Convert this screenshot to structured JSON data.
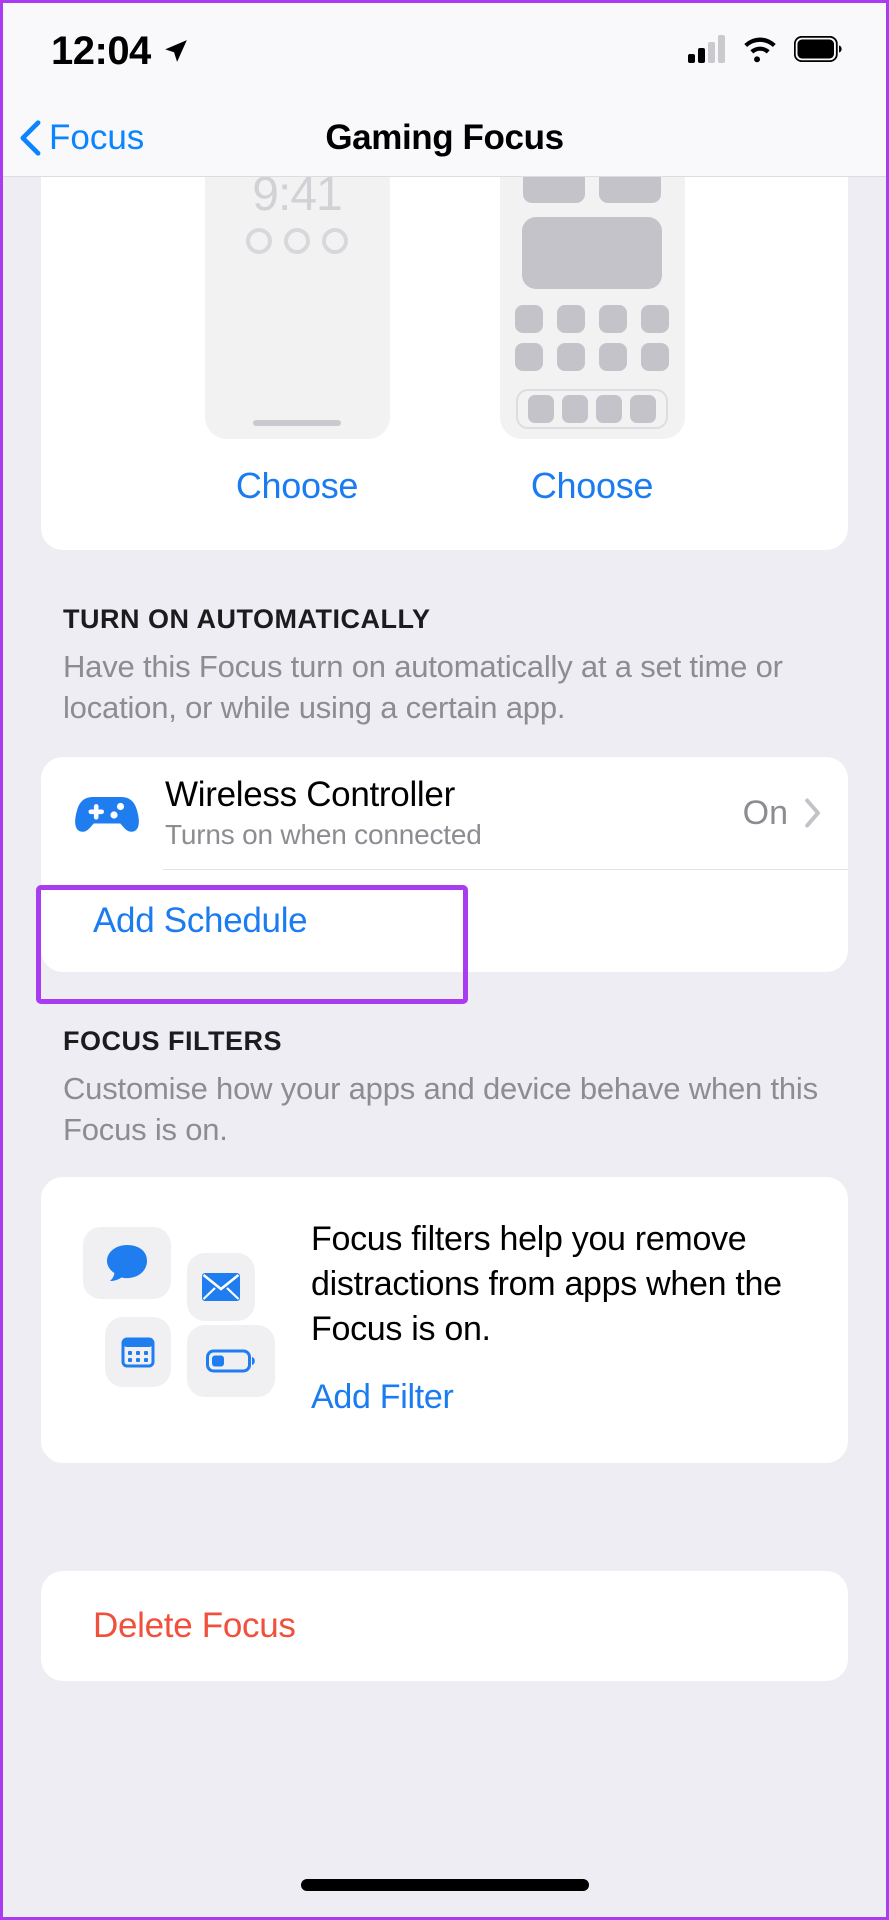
{
  "status_bar": {
    "time": "12:04",
    "location_icon": "location-arrow-icon",
    "cellular_icon": "cellular-signal-icon",
    "cellular_bars_filled": 2,
    "cellular_bars_total": 4,
    "wifi_icon": "wifi-icon",
    "battery_icon": "battery-full-icon"
  },
  "nav": {
    "back_label": "Focus",
    "back_icon": "chevron-left-icon",
    "title": "Gaming Focus"
  },
  "customise_section": {
    "lock_screen": {
      "time": "9:41",
      "choose_label": "Choose"
    },
    "home_screen": {
      "choose_label": "Choose"
    }
  },
  "turn_on_automatically": {
    "header": "TURN ON AUTOMATICALLY",
    "description": "Have this Focus turn on automatically at a set time or location, or while using a certain app.",
    "rows": [
      {
        "icon": "game-controller-icon",
        "title": "Wireless Controller",
        "subtitle": "Turns on when connected",
        "value": "On",
        "accessory": "chevron-right-icon",
        "highlighted": true
      }
    ],
    "add_schedule_label": "Add Schedule"
  },
  "focus_filters": {
    "header": "FOCUS FILTERS",
    "description": "Customise how your apps and device behave when this Focus is on.",
    "card_description": "Focus filters help you remove distractions from apps when the Focus is on.",
    "add_filter_label": "Add Filter",
    "icons": [
      "messages-icon",
      "mail-icon",
      "calendar-icon",
      "low-power-battery-icon"
    ]
  },
  "delete": {
    "label": "Delete Focus"
  },
  "colors": {
    "accent_blue": "#1a7cf0",
    "destructive_red": "#f0503c",
    "highlight_purple": "#a93cf0",
    "background": "#eeedf3",
    "card": "#ffffff",
    "secondary_text": "#8c8c92"
  }
}
